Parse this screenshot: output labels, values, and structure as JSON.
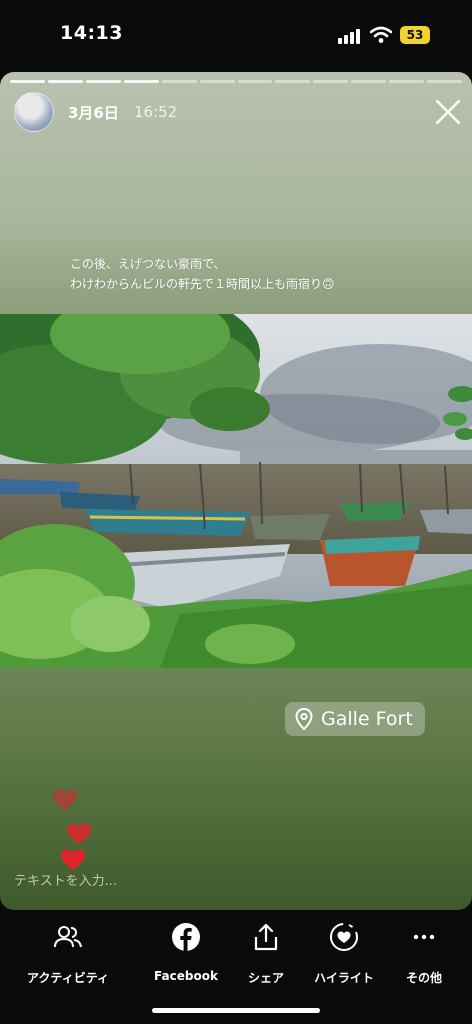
{
  "status": {
    "time": "14:13",
    "battery": "53"
  },
  "story": {
    "date": "3月6日",
    "hour": "16:52",
    "caption_lines": [
      "この後、えげつない豪雨で、",
      "わけわからんビルの軒先で１時間以上も雨宿り🙃"
    ],
    "location": "Galle Fort",
    "text_input_placeholder": "テキストを入力...",
    "progress_segments": 12,
    "progress_done": 4
  },
  "actions": [
    {
      "label": "アクティビティ",
      "icon": "people-icon"
    },
    {
      "label": "Facebook",
      "icon": "facebook-icon"
    },
    {
      "label": "シェア",
      "icon": "share-icon"
    },
    {
      "label": "ハイライト",
      "icon": "highlight-icon"
    },
    {
      "label": "その他",
      "icon": "more-icon"
    }
  ],
  "colors": {
    "battery": "#f2d22e",
    "heart": "#e0242a",
    "background": "#0a0a0a"
  }
}
